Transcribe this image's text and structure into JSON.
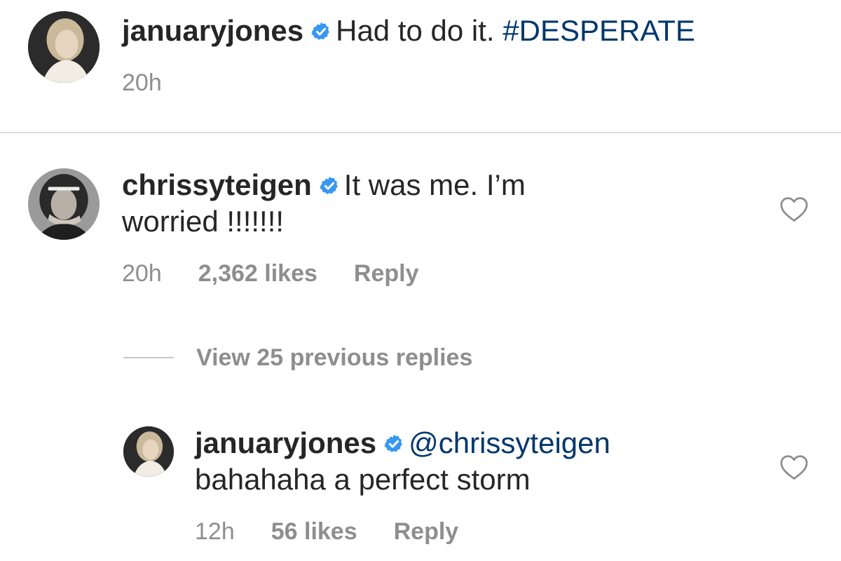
{
  "post": {
    "username": "januaryjones",
    "caption": "Had to do it.",
    "hashtag": "#DESPERATE",
    "time": "20h"
  },
  "comment": {
    "username": "chrissyteigen",
    "text_line1": "It was me. I’m",
    "text_line2": "worried !!!!!!!",
    "time": "20h",
    "likes": "2,362 likes",
    "reply": "Reply"
  },
  "view_replies": {
    "label": "View 25 previous replies"
  },
  "reply": {
    "username": "januaryjones",
    "mention": "@chrissyteigen",
    "text": "bahahaha a perfect storm",
    "time": "12h",
    "likes": "56 likes",
    "reply": "Reply"
  },
  "colors": {
    "verified_badge": "#3897f0",
    "link": "#00376b",
    "secondary_text": "#8e8e8e"
  },
  "icons": {
    "verified": "verified-badge-icon",
    "like": "heart-outline-icon"
  }
}
